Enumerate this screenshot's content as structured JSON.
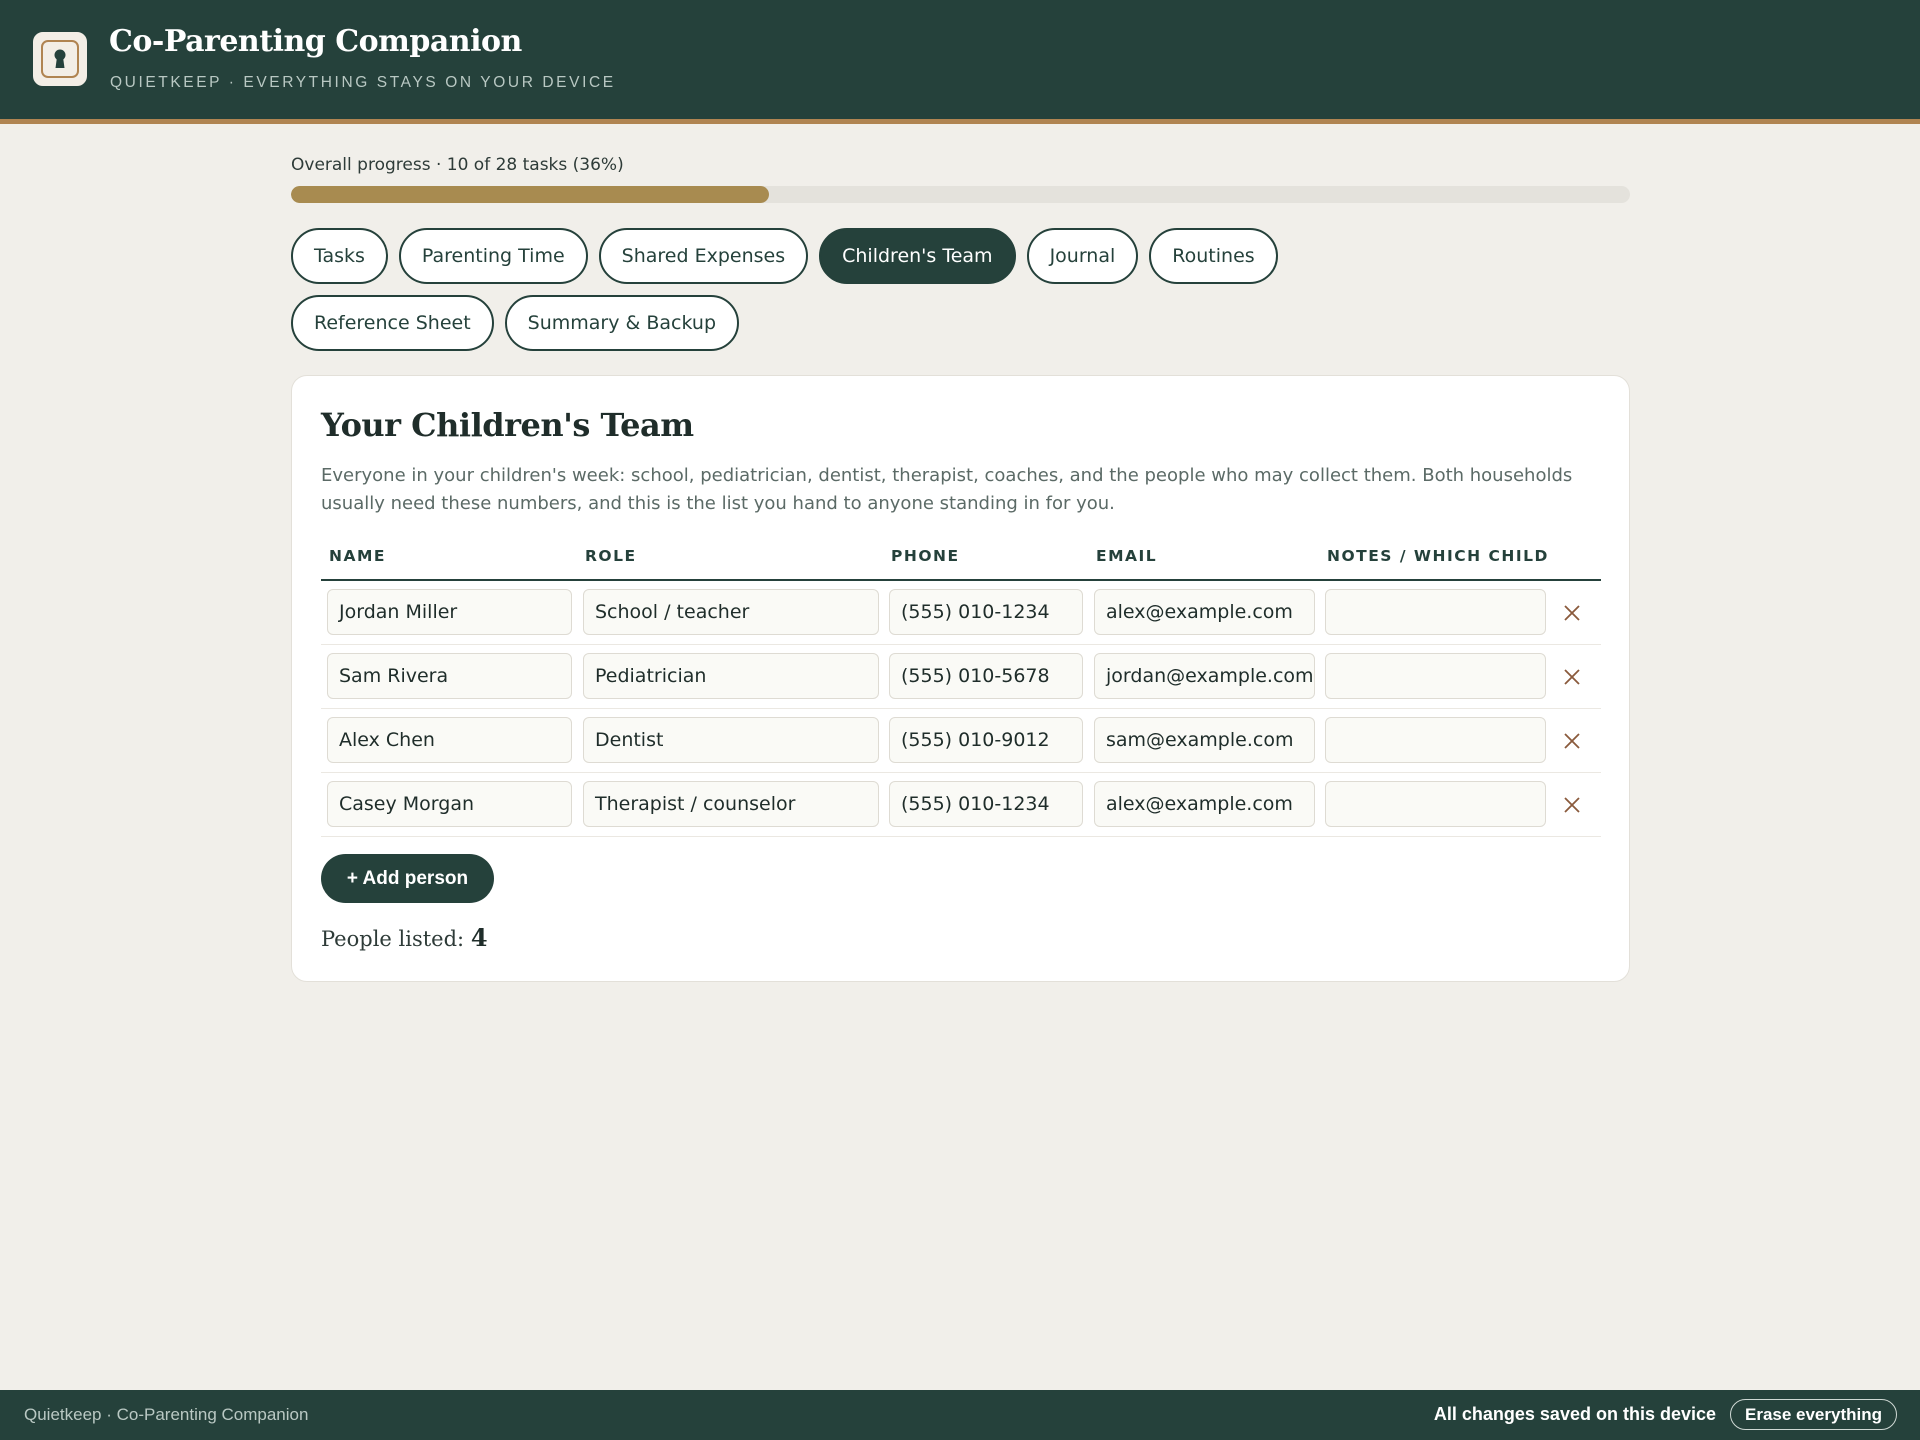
{
  "app": {
    "title": "Co-Parenting Companion",
    "subtitle": "QUIETKEEP · EVERYTHING STAYS ON YOUR DEVICE",
    "icon": "keyhole-icon"
  },
  "progress": {
    "label": "Overall progress · 10 of 28 tasks (36%)",
    "completed": 10,
    "total": 28,
    "percent": 36
  },
  "tabs": [
    {
      "label": "Tasks",
      "active": false
    },
    {
      "label": "Parenting Time",
      "active": false
    },
    {
      "label": "Shared Expenses",
      "active": false
    },
    {
      "label": "Children's Team",
      "active": true
    },
    {
      "label": "Journal",
      "active": false
    },
    {
      "label": "Routines",
      "active": false
    },
    {
      "label": "Reference Sheet",
      "active": false
    },
    {
      "label": "Summary & Backup",
      "active": false
    }
  ],
  "team": {
    "title": "Your Children's Team",
    "description": "Everyone in your children's week: school, pediatrician, dentist, therapist, coaches, and the people who may collect them. Both households usually need these numbers, and this is the list you hand to anyone standing in for you.",
    "columns": {
      "name": "NAME",
      "role": "ROLE",
      "phone": "PHONE",
      "email": "EMAIL",
      "notes": "NOTES / WHICH CHILD"
    },
    "rows": [
      {
        "name": "Jordan Miller",
        "role": "School / teacher",
        "phone": "(555) 010-1234",
        "email": "alex@example.com",
        "notes": ""
      },
      {
        "name": "Sam Rivera",
        "role": "Pediatrician",
        "phone": "(555) 010-5678",
        "email": "jordan@example.com",
        "notes": ""
      },
      {
        "name": "Alex Chen",
        "role": "Dentist",
        "phone": "(555) 010-9012",
        "email": "sam@example.com",
        "notes": ""
      },
      {
        "name": "Casey Morgan",
        "role": "Therapist / counselor",
        "phone": "(555) 010-1234",
        "email": "alex@example.com",
        "notes": ""
      }
    ],
    "add_label": "+ Add person",
    "count_label": "People listed:",
    "count_value": "4"
  },
  "footer": {
    "left": "Quietkeep · Co-Parenting Companion",
    "status": "All changes saved on this device",
    "erase_label": "Erase everything"
  },
  "colors": {
    "primary": "#25413b",
    "accent": "#b08451",
    "progress": "#a88b50",
    "background": "#f1efea"
  }
}
